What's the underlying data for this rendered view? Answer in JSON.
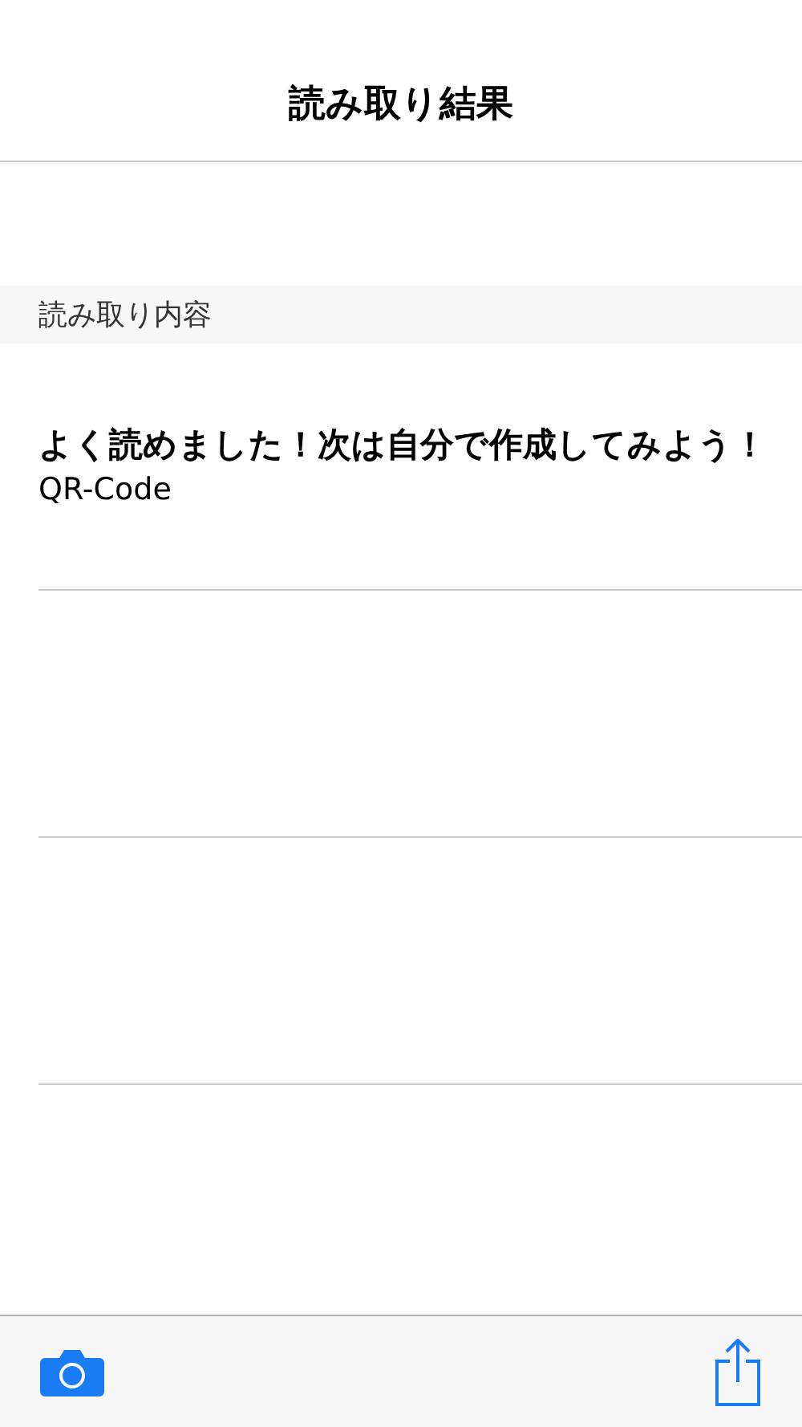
{
  "nav_bar": {
    "title": "読み取り結果"
  },
  "section": {
    "header": "読み取り内容",
    "rows": [
      {
        "text": "よく読めました！次は自分で作成してみよう！",
        "detail": "QR-Code"
      }
    ]
  },
  "tab_bar": {
    "buttons": [
      {
        "kind": "camera"
      },
      {
        "kind": "share"
      }
    ]
  }
}
